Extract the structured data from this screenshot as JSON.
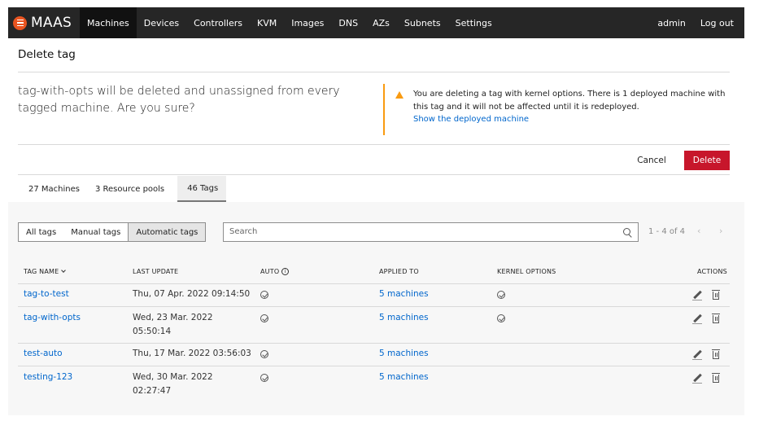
{
  "nav": {
    "brand": "MAAS",
    "items": [
      "Machines",
      "Devices",
      "Controllers",
      "KVM",
      "Images",
      "DNS",
      "AZs",
      "Subnets",
      "Settings"
    ],
    "active": "Machines",
    "user": "admin",
    "logout": "Log out"
  },
  "page": {
    "title": "Delete tag"
  },
  "confirm": {
    "message": "tag-with-opts will be deleted and unassigned from every tagged machine. Are you sure?",
    "warning": "You are deleting a tag with kernel options. There is 1 deployed machine with this tag and it will not be affected until it is redeployed.",
    "warning_link": "Show the deployed machine",
    "cancel": "Cancel",
    "delete": "Delete"
  },
  "tabs": [
    "27 Machines",
    "3 Resource pools",
    "46 Tags"
  ],
  "active_tab": "46 Tags",
  "filters": {
    "items": [
      "All tags",
      "Manual tags",
      "Automatic tags"
    ],
    "active": "Automatic tags"
  },
  "search": {
    "placeholder": "Search",
    "value": ""
  },
  "pagination": {
    "label": "1 - 4 of 4",
    "prev": "‹",
    "next": "›"
  },
  "table": {
    "headers": {
      "name": "TAG NAME",
      "updated": "LAST UPDATE",
      "auto": "AUTO",
      "applied": "APPLIED TO",
      "kernel": "KERNEL OPTIONS",
      "actions": "ACTIONS"
    },
    "rows": [
      {
        "name": "tag-to-test",
        "updated": "Thu, 07 Apr. 2022 09:14:50",
        "auto": true,
        "applied": "5 machines",
        "kernel": true
      },
      {
        "name": "tag-with-opts",
        "updated": "Wed, 23 Mar. 2022 05:50:14",
        "auto": true,
        "applied": "5 machines",
        "kernel": true
      },
      {
        "name": "test-auto",
        "updated": "Thu, 17 Mar. 2022 03:56:03",
        "auto": true,
        "applied": "5 machines",
        "kernel": false
      },
      {
        "name": "testing-123",
        "updated": "Wed, 30 Mar. 2022 02:27:47",
        "auto": true,
        "applied": "5 machines",
        "kernel": false
      }
    ]
  },
  "icons": {
    "warning": "warning-icon",
    "search": "search-icon",
    "check": "check-circle-icon",
    "edit": "edit-icon",
    "delete": "trash-icon",
    "info": "info-icon",
    "sort": "chevron-down-icon"
  },
  "colors": {
    "nav": "#262626",
    "accent": "#e95420",
    "danger": "#c7162b",
    "warning": "#f99b11",
    "link": "#0066cc"
  }
}
